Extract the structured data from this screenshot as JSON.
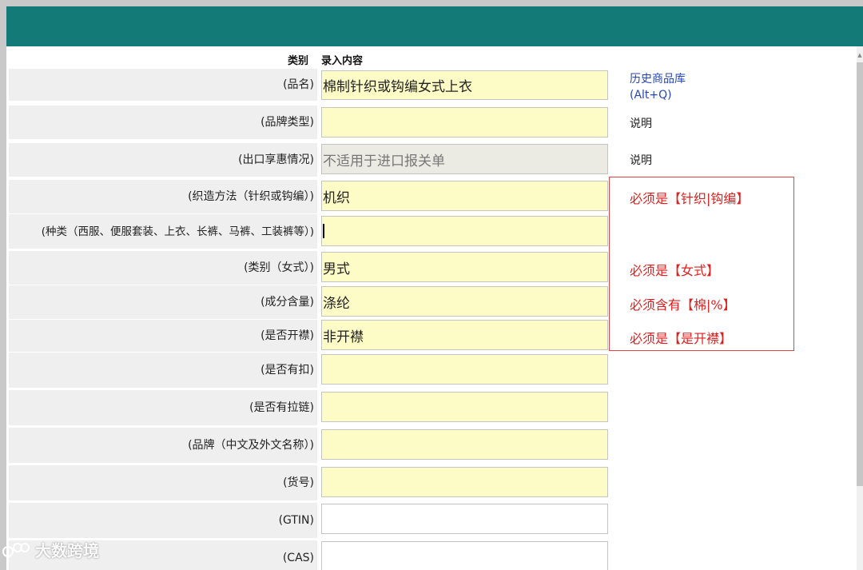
{
  "header": {
    "category_label": "类别",
    "input_label": "录入内容"
  },
  "rows": [
    {
      "label": "(品名)",
      "value": "棉制针织或钩编女式上衣",
      "side_link": "历史商品库\n(Alt+Q)"
    },
    {
      "label": "(品牌类型)",
      "value": "",
      "side": "说明"
    },
    {
      "label": "(出口享惠情况)",
      "value": "",
      "placeholder": "不适用于进口报关单",
      "side": "说明"
    },
    {
      "label": "(织造方法（针织或钩编）)",
      "value": "机织",
      "error": "必须是【针织|钩编】"
    },
    {
      "label": "(种类（西服、便服套装、上衣、长裤、马裤、工装裤等）)",
      "value": ""
    },
    {
      "label": "(类别（女式）)",
      "value": "男式",
      "error": "必须是【女式】"
    },
    {
      "label": "(成分含量)",
      "value": "涤纶",
      "error": "必须含有【棉|%】"
    },
    {
      "label": "(是否开襟)",
      "value": "非开襟",
      "error": "必须是【是开襟】"
    },
    {
      "label": "(是否有扣)",
      "value": ""
    },
    {
      "label": "(是否有拉链)",
      "value": ""
    },
    {
      "label": "(品牌（中文及外文名称）)",
      "value": ""
    },
    {
      "label": "(货号)",
      "value": ""
    },
    {
      "label": "(GTIN)",
      "value": ""
    },
    {
      "label": "(CAS)",
      "value": ""
    }
  ],
  "watermark": "大数跨境",
  "colors": {
    "titlebar": "#137a78",
    "input_required": "#fdfcc6",
    "error": "#e02020",
    "link": "#2646b6"
  }
}
